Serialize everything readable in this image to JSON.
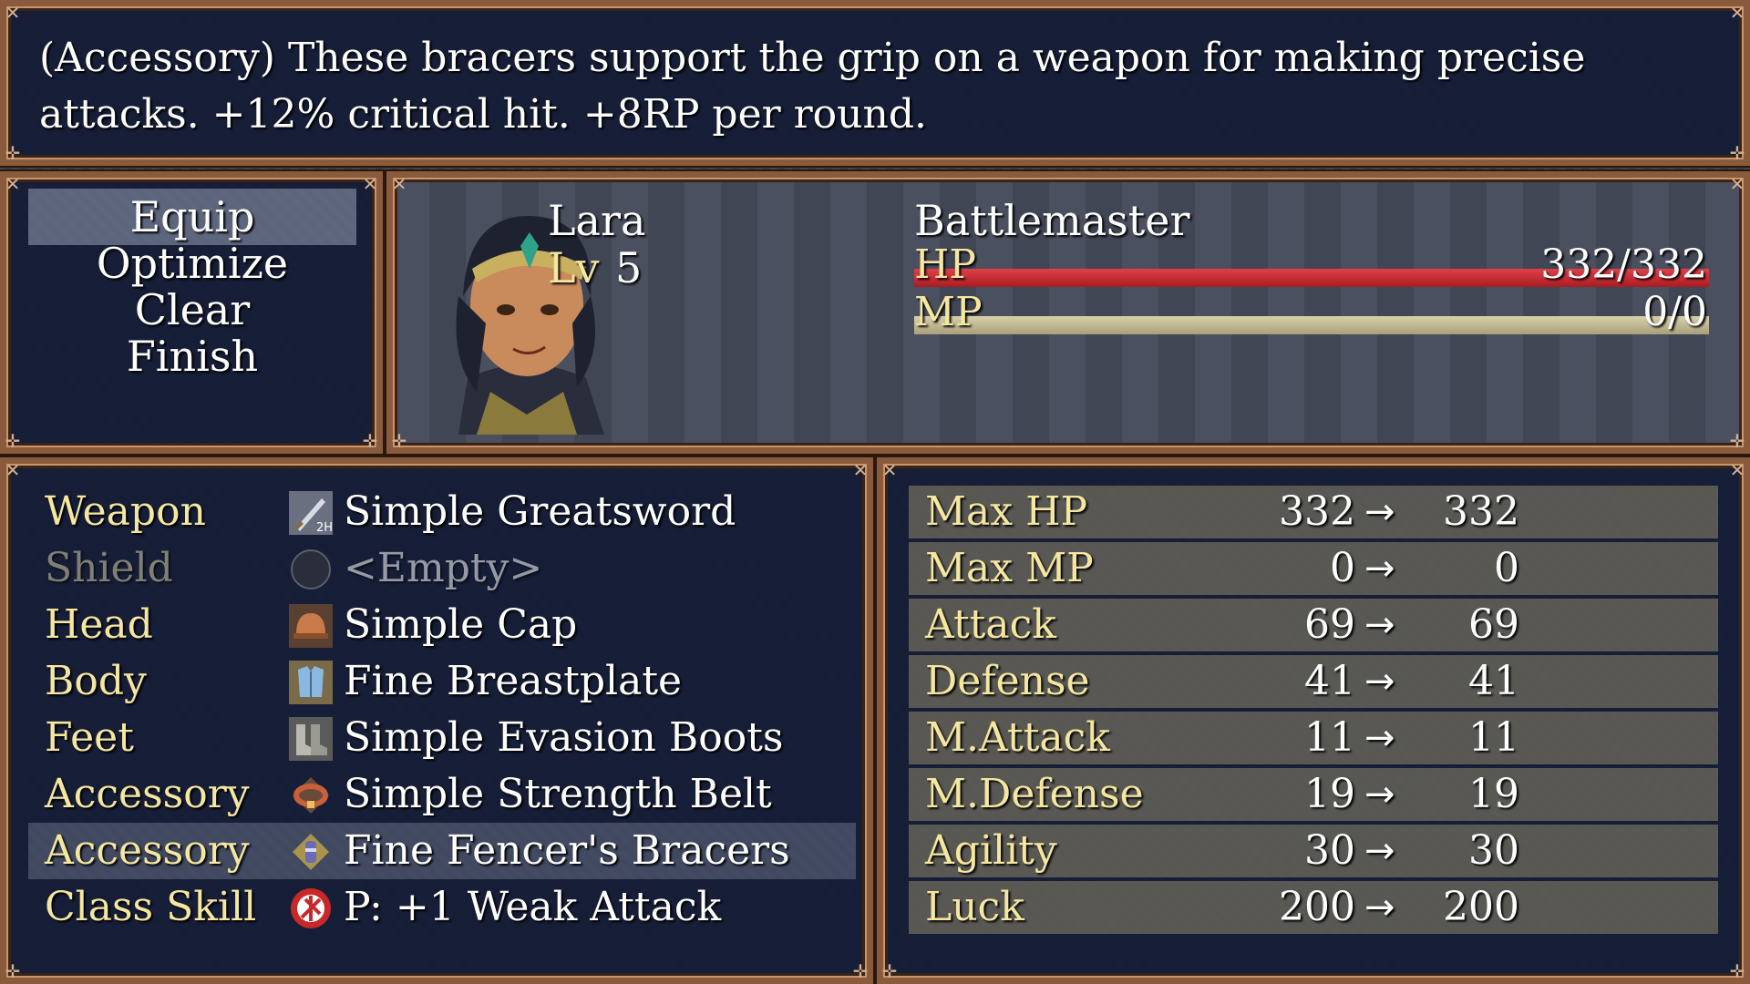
{
  "help": {
    "text": "(Accessory) These bracers support the grip on a weapon for making precise attacks. +12% critical hit. +8RP per round."
  },
  "commands": [
    {
      "label": "Equip",
      "selected": true
    },
    {
      "label": "Optimize"
    },
    {
      "label": "Clear"
    },
    {
      "label": "Finish"
    }
  ],
  "actor": {
    "name": "Lara",
    "level_label": "Lv",
    "level": "5",
    "class": "Battlemaster",
    "hp_label": "HP",
    "hp_value": "332/332",
    "hp_fill": 1.0,
    "mp_label": "MP",
    "mp_value": "0/0",
    "mp_fill": 1.0
  },
  "slots": [
    {
      "label": "Weapon",
      "item": "Simple Greatsword",
      "icon": "greatsword-icon"
    },
    {
      "label": "Shield",
      "item": "<Empty>",
      "icon": "empty-slot-icon",
      "disabled": true
    },
    {
      "label": "Head",
      "item": "Simple Cap",
      "icon": "cap-icon"
    },
    {
      "label": "Body",
      "item": "Fine Breastplate",
      "icon": "breastplate-icon"
    },
    {
      "label": "Feet",
      "item": "Simple Evasion Boots",
      "icon": "boots-icon"
    },
    {
      "label": "Accessory",
      "item": "Simple Strength Belt",
      "icon": "belt-icon"
    },
    {
      "label": "Accessory",
      "item": "Fine Fencer's Bracers",
      "icon": "bracers-icon",
      "selected": true
    },
    {
      "label": "Class Skill",
      "item": "P: +1 Weak Attack",
      "icon": "skill-icon"
    }
  ],
  "params": [
    {
      "name": "Max HP",
      "current": "332",
      "arrow": "→",
      "new": "332"
    },
    {
      "name": "Max MP",
      "current": "0",
      "arrow": "→",
      "new": "0"
    },
    {
      "name": "Attack",
      "current": "69",
      "arrow": "→",
      "new": "69"
    },
    {
      "name": "Defense",
      "current": "41",
      "arrow": "→",
      "new": "41"
    },
    {
      "name": "M.Attack",
      "current": "11",
      "arrow": "→",
      "new": "11"
    },
    {
      "name": "M.Defense",
      "current": "19",
      "arrow": "→",
      "new": "19"
    },
    {
      "name": "Agility",
      "current": "30",
      "arrow": "→",
      "new": "30"
    },
    {
      "name": "Luck",
      "current": "200",
      "arrow": "→",
      "new": "200"
    }
  ],
  "colors": {
    "hp_gauge": "#c0282c",
    "mp_gauge": "#b8b08a",
    "system_text": "#f5e6a0",
    "window_frame": "#8a5a3c"
  }
}
